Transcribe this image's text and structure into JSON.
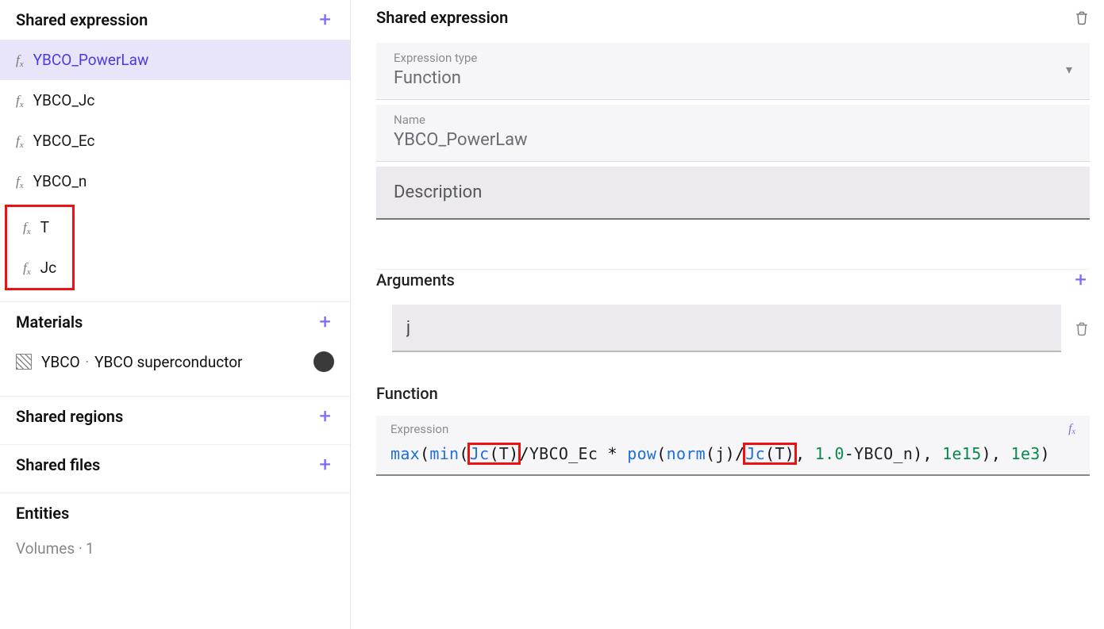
{
  "sidebar": {
    "sharedExpression": {
      "title": "Shared expression",
      "items": [
        {
          "label": "YBCO_PowerLaw",
          "selected": true
        },
        {
          "label": "YBCO_Jc"
        },
        {
          "label": "YBCO_Ec"
        },
        {
          "label": "YBCO_n"
        },
        {
          "label": "T",
          "highlighted": true
        },
        {
          "label": "Jc",
          "highlighted": true
        }
      ]
    },
    "materials": {
      "title": "Materials",
      "items": [
        {
          "short": "YBCO",
          "full": "YBCO superconductor"
        }
      ]
    },
    "sharedRegions": {
      "title": "Shared regions"
    },
    "sharedFiles": {
      "title": "Shared files"
    },
    "entities": {
      "title": "Entities",
      "volumesLabel": "Volumes",
      "volumesCount": "1"
    }
  },
  "main": {
    "title": "Shared expression",
    "expressionType": {
      "label": "Expression type",
      "value": "Function"
    },
    "name": {
      "label": "Name",
      "value": "YBCO_PowerLaw"
    },
    "description": {
      "placeholder": "Description"
    },
    "arguments": {
      "title": "Arguments",
      "items": [
        {
          "value": "j"
        }
      ]
    },
    "function": {
      "title": "Function",
      "expressionLabel": "Expression",
      "tokens": {
        "max": "max",
        "min": "min",
        "jc": "Jc",
        "t": "T",
        "ybco_ec": "YBCO_Ec",
        "pow": "pow",
        "norm": "norm",
        "j": "j",
        "one": "1.0",
        "ybco_n": "YBCO_n",
        "e15": "1e15",
        "e3": "1e3"
      }
    }
  }
}
